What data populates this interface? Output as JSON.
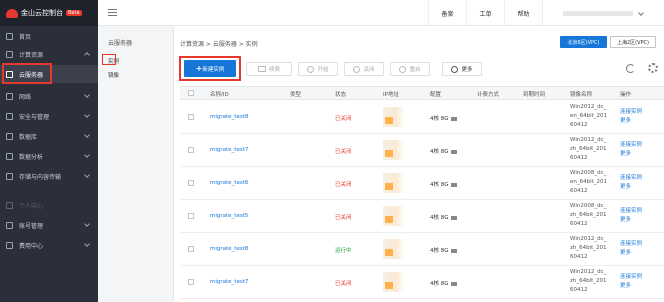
{
  "app": {
    "brand": "金山云控制台",
    "beta": "Beta"
  },
  "leftnav": {
    "items": [
      {
        "label": "首页",
        "icon": "home-icon",
        "chevron": false
      },
      {
        "label": "计算资源",
        "icon": "server-icon",
        "chevron": true
      },
      {
        "label": "云服务器",
        "icon": "vm-icon",
        "chevron": false
      },
      {
        "label": "网络",
        "icon": "network-icon",
        "chevron": true
      },
      {
        "label": "安全与管理",
        "icon": "shield-icon",
        "chevron": true
      },
      {
        "label": "数据库",
        "icon": "database-icon",
        "chevron": true
      },
      {
        "label": "数据分析",
        "icon": "chart-icon",
        "chevron": true
      },
      {
        "label": "存储与内容传输",
        "icon": "storage-icon",
        "chevron": true
      },
      {
        "label": "个人中心",
        "icon": "user-icon",
        "chevron": false
      },
      {
        "label": "账号管理",
        "icon": "account-icon",
        "chevron": true
      },
      {
        "label": "费用中心",
        "icon": "billing-icon",
        "chevron": true
      }
    ]
  },
  "topbar": {
    "items": [
      "备案",
      "工单",
      "帮助"
    ]
  },
  "subnav": {
    "title": "云服务器",
    "items": [
      "实例",
      "镜像"
    ]
  },
  "main": {
    "breadcrumb": "计算资源 > 云服务器 > 实例",
    "region_active": "北京6区(VPC)",
    "region_other": "上海2区(VPC)",
    "create": "新建实例",
    "toolbar": [
      "续费",
      "开始",
      "关闭",
      "重启"
    ],
    "more": "更多"
  },
  "table": {
    "headers": [
      "名称/ID",
      "类型",
      "状态",
      "IP地址",
      "配置",
      "计费方式",
      "到期时间",
      "镜像名称",
      "操作"
    ],
    "rows": [
      {
        "name": "migrate_test8",
        "status": "已关闭",
        "config": "4核 8G",
        "image": [
          "Win2012_dc_",
          "en_64bit_201",
          "60412"
        ],
        "op": "连接实例",
        "more": "更多"
      },
      {
        "name": "migrate_test7",
        "status": "已关闭",
        "config": "4核 8G",
        "image": [
          "Win2012_dc_",
          "zh_64bit_201",
          "60412"
        ],
        "op": "连接实例",
        "more": "更多"
      },
      {
        "name": "migrate_test6",
        "status": "已关闭",
        "config": "4核 8G",
        "image": [
          "Win2008_dc_",
          "en_64bit_201",
          "60412"
        ],
        "op": "连接实例",
        "more": "更多"
      },
      {
        "name": "migrate_test5",
        "status": "已关闭",
        "config": "4核 8G",
        "image": [
          "Win2008_dc_",
          "zh_64bit_201",
          "60412"
        ],
        "op": "连接实例",
        "more": "更多"
      },
      {
        "name": "migrate_test8",
        "status": "运行中",
        "config": "4核 8G",
        "image": [
          "Win2012_dc_",
          "zh_64bit_201",
          "60412"
        ],
        "op": "连接实例",
        "more": "更多"
      },
      {
        "name": "migrate_test7",
        "status": "已关闭",
        "config": "4核 8G",
        "image": [
          "Win2012_dc_",
          "zh_64bit_201",
          "60412"
        ],
        "op": "连接实例",
        "more": "更多"
      }
    ]
  },
  "colors": {
    "accent": "#1677d8",
    "danger": "#e8382e",
    "running": "#2a9d3a",
    "nav_bg": "#2b2f3a"
  }
}
